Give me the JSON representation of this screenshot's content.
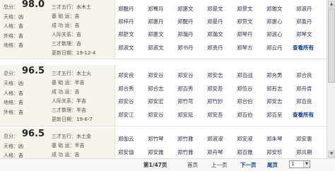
{
  "labels": {
    "score_prefix": "总分：",
    "heaven": "天格：",
    "person": "人格：",
    "earth": "地格：",
    "outer": "外格：",
    "sancai": "三才五行：",
    "base": "基 础 运：",
    "success": "成 功 运：",
    "social": "人际关系：",
    "sancai_num": "三才数理：",
    "updated": "更新日期："
  },
  "cards": [
    {
      "score": "98.0",
      "heaven": "凶",
      "person": "吉",
      "earth": "吉",
      "outer": "吉",
      "sancai": "水木土",
      "base": "吉",
      "success": "吉",
      "social": "吉",
      "sancai_num": "吉",
      "updated": "19-12-4",
      "names": [
        "郑醒丹",
        "郑骞月",
        "郑惠文",
        "郑曼文",
        "郑景文",
        "郑雅文",
        "郑淑丹",
        "郑梓丹",
        "郑惠丹",
        "郑醒丹",
        "郑曼丹",
        "郑贺文",
        "郑惠心",
        "郑盈丹",
        "郑舒文",
        "郑惠文",
        "郑瀚丹",
        "郑瀚文",
        "郑琴丹",
        "郑淑心",
        "郑琴文",
        "郑淑文",
        "郑淑文",
        "郑书丹",
        "郑贵丹",
        "郑琴方",
        "郑云丹",
        "郑云丹"
      ],
      "view_all": "查看所有"
    },
    {
      "score": "96.5",
      "heaven": "凶",
      "person": "吉",
      "earth": "吉",
      "outer": "吉",
      "sancai": "水土火",
      "base": "半吉",
      "success": "吉",
      "social": "半吉",
      "sancai_num": "半吉",
      "updated": "19-6-7",
      "names": [
        "郑安良",
        "郑安谷",
        "郑安谷",
        "郑安志",
        "郑百战",
        "郑充男",
        "郑合良",
        "郑合秀",
        "郑合志",
        "郑百秀",
        "郑安吾",
        "郑伍谷",
        "郑有志",
        "郑舟肯",
        "郑安谷",
        "郑安宏",
        "郑竹芎",
        "郑竹妙",
        "郑合伯",
        "郑安志",
        "郑百良",
        "郑安江",
        "郑安谷",
        "郑安延",
        "郑安吾",
        "郑百伯",
        "郑百呈",
        "郑百吕"
      ],
      "view_all": "查看所有"
    },
    {
      "score": "96.5",
      "heaven": "凶",
      "person": "吉",
      "earth": "吉",
      "outer": "吉",
      "sancai": "水土金",
      "base": "半吉",
      "success": "吉",
      "social": "半吉",
      "sancai_num": "",
      "updated": "",
      "names": [
        "郑伽云",
        "郑竹琴",
        "郑竹雅",
        "郑淑淑",
        "郑安淑",
        "郑朱琴",
        "郑安惠",
        "郑安伽",
        "郑安雅",
        "郑竹雅",
        "郑舟琴",
        "郑百雅",
        "郑安珍",
        "郑共期"
      ],
      "view_all": ""
    }
  ],
  "pagination": {
    "current": "第1/47页",
    "first": "首页",
    "prev": "上一页",
    "next": "下一页",
    "last": "尾页",
    "page_select": "1"
  },
  "colors": {
    "info_bg": "#f5f3ea",
    "view_all": "#0b3a8a"
  }
}
